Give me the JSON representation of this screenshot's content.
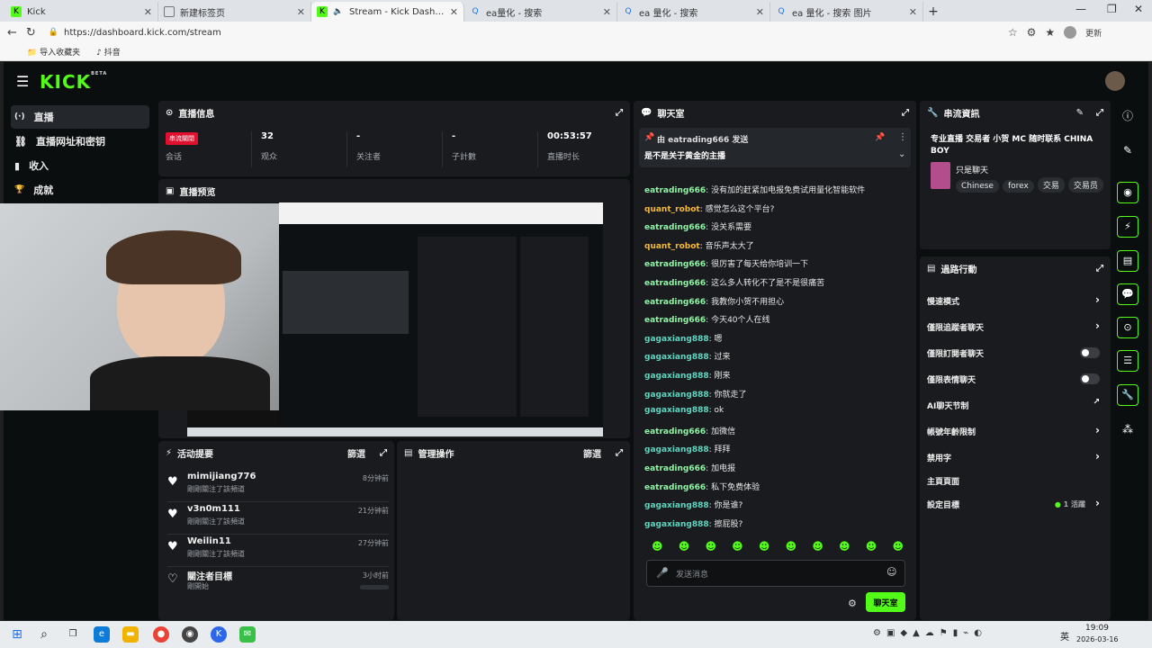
{
  "browser": {
    "tabs": [
      {
        "title": "Kick",
        "icon": "K"
      },
      {
        "title": "新建标签页",
        "icon": ""
      },
      {
        "title": "Stream - Kick Dashboard",
        "icon": "K"
      },
      {
        "title": "ea量化 - 搜索",
        "icon": ""
      },
      {
        "title": "ea 量化 - 搜索",
        "icon": ""
      },
      {
        "title": "ea 量化 - 搜索 图片",
        "icon": ""
      }
    ],
    "url": "https://dashboard.kick.com/stream",
    "bookmarks": [
      "导入收藏夹",
      "抖音"
    ],
    "right_label": "更新"
  },
  "app": {
    "logo": "KICK",
    "logo_sup": "BETA",
    "sidebar": [
      {
        "label": "直播",
        "icon": "(·)"
      },
      {
        "label": "直播网址和密钥",
        "icon": "⛓"
      },
      {
        "label": "收入",
        "icon": "▮"
      },
      {
        "label": "成就",
        "icon": "🏆"
      }
    ],
    "stream_info": {
      "title": "直播信息",
      "live_badge": "串流關閉",
      "session_label": "会话",
      "stats": [
        {
          "value": "32",
          "label": "观众"
        },
        {
          "value": "-",
          "label": "关注者"
        },
        {
          "value": "-",
          "label": "子計數"
        },
        {
          "value": "00:53:57",
          "label": "直播时长"
        }
      ]
    },
    "preview": {
      "title": "直播预览"
    },
    "activity": {
      "title": "活动提要",
      "filter": "篩選",
      "items": [
        {
          "name": "mimijiang776",
          "desc": "剛剛關注了該頻道",
          "time": "8分钟前",
          "icon": "♥"
        },
        {
          "name": "v3n0m111",
          "desc": "剛剛關注了該頻道",
          "time": "21分钟前",
          "icon": "♥"
        },
        {
          "name": "Weilin11",
          "desc": "剛剛關注了該頻道",
          "time": "27分钟前",
          "icon": "♥"
        },
        {
          "name": "關注者目標",
          "desc": "剛開始",
          "time": "3小时前",
          "icon": "♡"
        }
      ]
    },
    "mod_actions": {
      "title": "管理操作",
      "filter": "篩選"
    },
    "chat": {
      "title": "聊天室",
      "pinned_by": "由 eatrading666 发送",
      "pinned_text": "是不是关于黄金的主播",
      "messages": [
        {
          "user": "eatrading666",
          "text": "没有加的赶紧加电报免费试用量化智能软件",
          "color": "#8ff5a5"
        },
        {
          "user": "quant_robot",
          "text": "感觉怎么这个平台?",
          "color": "#f5b83a"
        },
        {
          "user": "eatrading666",
          "text": "没关系需要",
          "color": "#8ff5a5"
        },
        {
          "user": "quant_robot",
          "text": "音乐声太大了",
          "color": "#f5b83a"
        },
        {
          "user": "eatrading666",
          "text": "很厉害了每天给你培训一下",
          "color": "#8ff5a5"
        },
        {
          "user": "eatrading666",
          "text": "这么多人转化不了是不是很痛苦",
          "color": "#8ff5a5"
        },
        {
          "user": "eatrading666",
          "text": "我教你小贺不用担心",
          "color": "#8ff5a5"
        },
        {
          "user": "eatrading666",
          "text": "今天40个人在线",
          "color": "#8ff5a5"
        },
        {
          "user": "gagaxiang888",
          "text": "嗯",
          "color": "#5fd6c0"
        },
        {
          "user": "gagaxiang888",
          "text": "过来",
          "color": "#5fd6c0"
        },
        {
          "user": "gagaxiang888",
          "text": "刚来",
          "color": "#5fd6c0"
        },
        {
          "user": "gagaxiang888",
          "text": "你就走了",
          "color": "#5fd6c0"
        },
        {
          "user": "gagaxiang888",
          "text": "ok",
          "color": "#5fd6c0"
        },
        {
          "user": "eatrading666",
          "text": "加微信",
          "color": "#8ff5a5"
        },
        {
          "user": "gagaxiang888",
          "text": "拜拜",
          "color": "#5fd6c0"
        },
        {
          "user": "eatrading666",
          "text": "加电报",
          "color": "#8ff5a5"
        },
        {
          "user": "eatrading666",
          "text": "私下免费体验",
          "color": "#8ff5a5"
        },
        {
          "user": "gagaxiang888",
          "text": "你是谁?",
          "color": "#5fd6c0"
        },
        {
          "user": "gagaxiang888",
          "text": "擦屁股?",
          "color": "#5fd6c0"
        }
      ],
      "input_placeholder": "发送消息",
      "send_label": "聊天室"
    },
    "stream_details": {
      "title": "串流資訊",
      "stream_title": "专业直播 交易者 小贺 MC 随时联系 CHINA BOY",
      "category": "只是聊天",
      "tags": [
        "Chinese",
        "forex",
        "交易",
        "交易员"
      ]
    },
    "moderation": {
      "title": "過路行動",
      "rows": [
        {
          "label": "慢速模式",
          "control": "chevron"
        },
        {
          "label": "僅限追蹤者聊天",
          "control": "chevron"
        },
        {
          "label": "僅限訂閱者聊天",
          "control": "toggle"
        },
        {
          "label": "僅限表情聊天",
          "control": "toggle"
        },
        {
          "label": "AI聊天节制",
          "control": "external"
        },
        {
          "label": "帳號年齡限制",
          "control": "chevron"
        },
        {
          "label": "禁用字",
          "control": "chevron"
        },
        {
          "label": "主頁頁面",
          "control": "none"
        },
        {
          "label": "設定目標",
          "control": "chevron"
        }
      ],
      "goal_status": "1 活躍"
    }
  },
  "taskbar": {
    "time": "19:09",
    "date": "2026-03-16",
    "lang": "英"
  },
  "colors": {
    "accent": "#53fc18",
    "live": "#e0102f"
  }
}
